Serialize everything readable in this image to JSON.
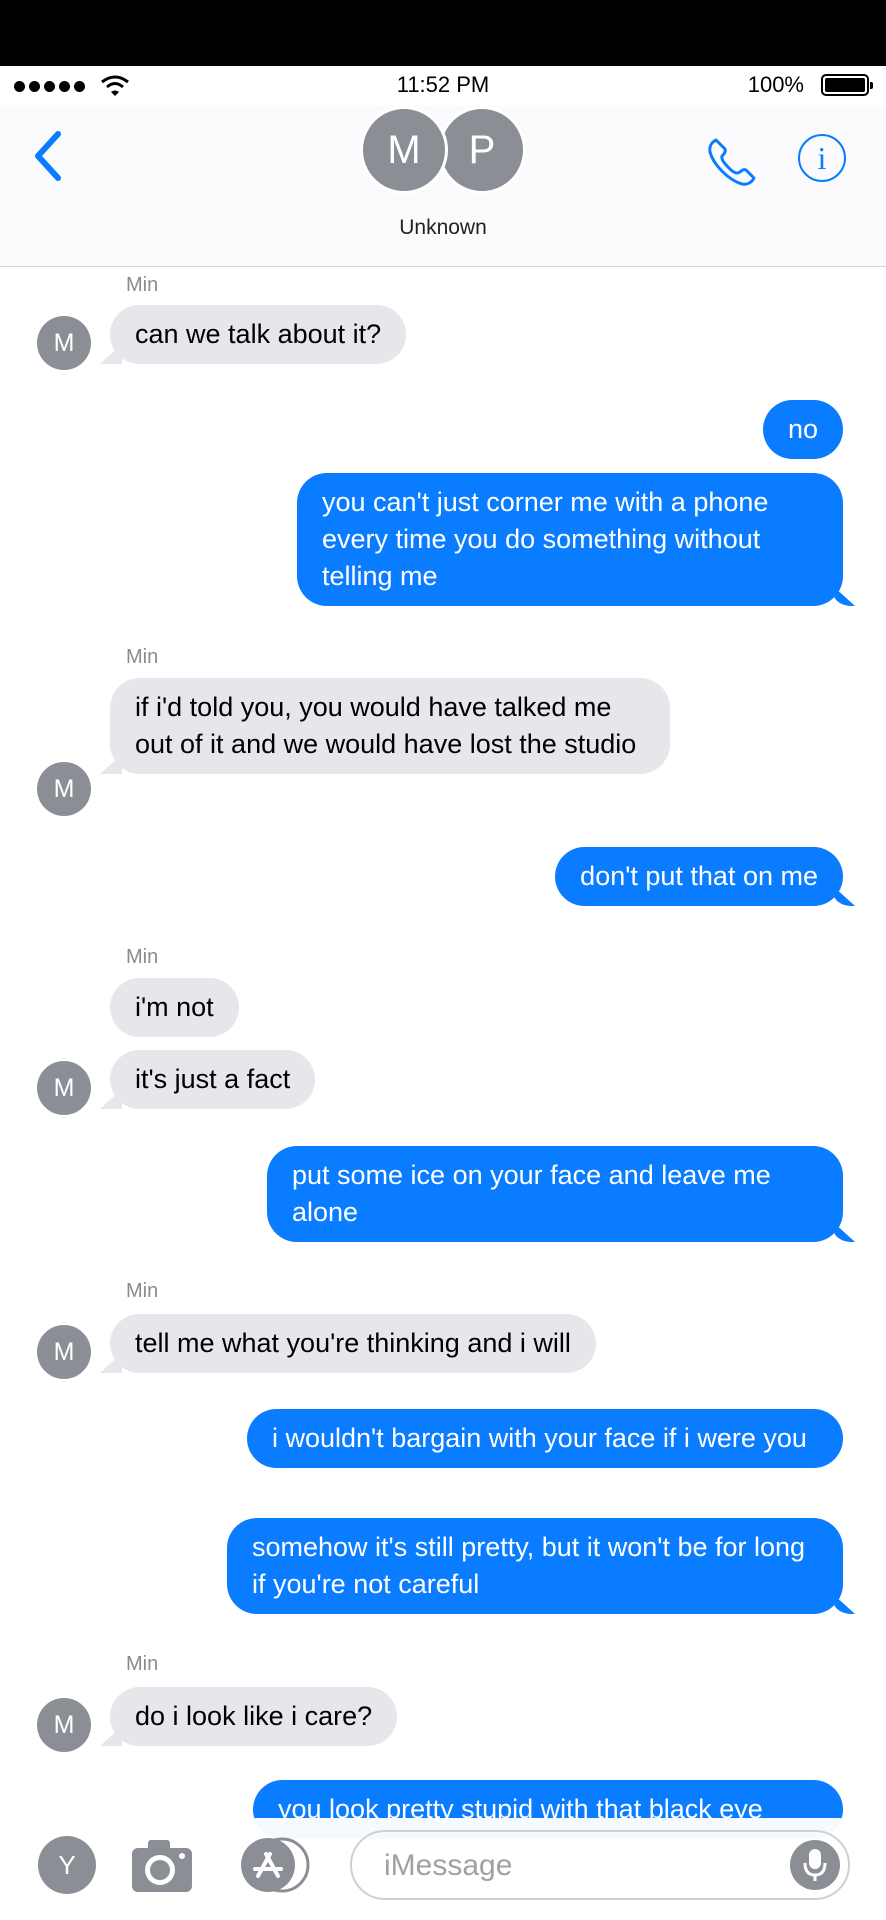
{
  "status": {
    "time": "11:52 PM",
    "battery": "100%"
  },
  "header": {
    "avatar_m": "M",
    "avatar_p": "P",
    "contact": "Unknown"
  },
  "messages": [
    {
      "sender": "Min",
      "text": "can we talk about it?"
    },
    {
      "text": "no"
    },
    {
      "text": "you can't just corner me with a phone every time you do something without telling me"
    },
    {
      "sender": "Min",
      "text": "if i'd told you, you would have talked me out of it and we would have lost the studio"
    },
    {
      "text": "don't put that on me"
    },
    {
      "sender": "Min",
      "text": "i'm not"
    },
    {
      "text": "it's just a fact"
    },
    {
      "text": "put some ice on your face and leave me alone"
    },
    {
      "sender": "Min",
      "text": "tell me what you're thinking and i will"
    },
    {
      "text": "i wouldn't bargain with your face if i were you"
    },
    {
      "text": "somehow it's still pretty, but it won't be for long if you're not careful"
    },
    {
      "sender": "Min",
      "text": "do i look like i care?"
    },
    {
      "text": "you look pretty stupid with that black eye"
    }
  ],
  "avatar_initial": "M",
  "bottom": {
    "app_initial": "Y",
    "placeholder": "iMessage"
  },
  "colors": {
    "accent": "#0a7cff",
    "incoming": "#e6e6eb",
    "avatar": "#8c8e96"
  }
}
